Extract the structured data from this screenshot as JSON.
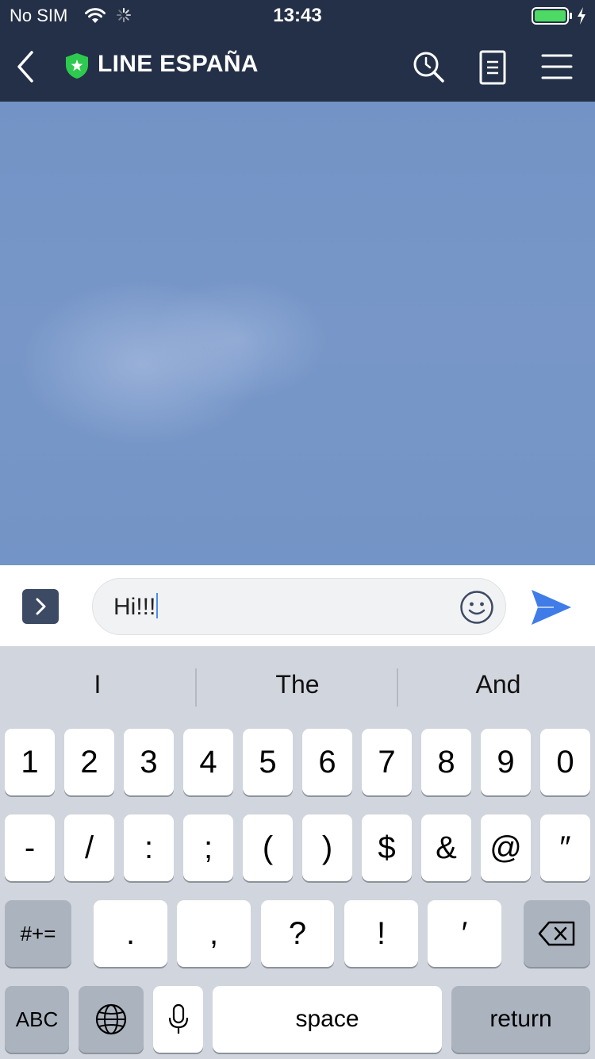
{
  "status_bar": {
    "carrier": "No SIM",
    "time": "13:43"
  },
  "header": {
    "title": "LINE ESPAÑA"
  },
  "input": {
    "text": "Hi!!!"
  },
  "keyboard": {
    "suggestions": [
      "I",
      "The",
      "And"
    ],
    "row1": [
      "1",
      "2",
      "3",
      "4",
      "5",
      "6",
      "7",
      "8",
      "9",
      "0"
    ],
    "row2": [
      "-",
      "/",
      ":",
      ";",
      "(",
      ")",
      "$",
      "&",
      "@",
      "″"
    ],
    "row3": [
      ".",
      ",",
      "?",
      "!",
      "′"
    ],
    "symbols_label": "#+=",
    "abc_label": "ABC",
    "space_label": "space",
    "return_label": "return"
  },
  "colors": {
    "header_bg": "#243047",
    "chat_bg": "#7595c7",
    "send_blue": "#3f7ce8",
    "shield_green": "#2ec94f"
  }
}
